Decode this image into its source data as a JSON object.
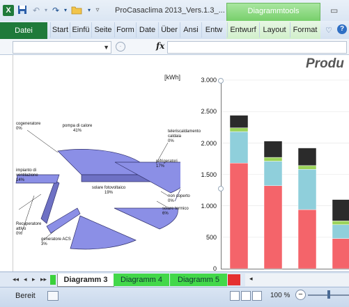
{
  "window": {
    "title": "ProCasaclima 2013_Vers.1.3_...",
    "contextual_group": "Diagrammtools"
  },
  "ribbon": {
    "file_tab": "Datei",
    "tabs": [
      "Start",
      "Einfü",
      "Seite",
      "Form",
      "Date",
      "Über",
      "Ansi",
      "Entw"
    ],
    "chart_tabs": [
      "Entwurf",
      "Layout",
      "Format"
    ]
  },
  "formula_bar": {
    "fx_label": "fx",
    "value": ""
  },
  "chart": {
    "title": "Produ",
    "unit_label": "[kWh]",
    "y_ticks": [
      "3.000",
      "2.500",
      "2.000",
      "1.500",
      "1.000",
      "500",
      "0"
    ],
    "pie_labels": [
      {
        "name": "cogeneratore",
        "pct": "0%"
      },
      {
        "name": "pompa di calore",
        "pct": "41%"
      },
      {
        "name": "teleriscaldamento caldaia",
        "pct": "0%"
      },
      {
        "name": "refrigeratori",
        "pct": "17%"
      },
      {
        "name": "impianto di ventilazione",
        "pct": "14%"
      },
      {
        "name": "solare fotovoltaico",
        "pct": "19%"
      },
      {
        "name": "non coperto",
        "pct": "0%"
      },
      {
        "name": "solare termico",
        "pct": "6%"
      },
      {
        "name": "Recuperatore attivo",
        "pct": "0%"
      },
      {
        "name": "generatore ACS",
        "pct": "3%"
      }
    ]
  },
  "chart_data": {
    "type": "bar",
    "ylabel": "[kWh]",
    "ylim": [
      0,
      3000
    ],
    "stacked": true,
    "series_colors": [
      "#f4646a",
      "#8fcfdb",
      "#9bd35a",
      "#2b2b2b"
    ],
    "series": [
      {
        "values": [
          1680,
          1320,
          940,
          480
        ]
      },
      {
        "values": [
          500,
          390,
          640,
          220
        ]
      },
      {
        "values": [
          60,
          60,
          60,
          60
        ]
      },
      {
        "values": [
          200,
          260,
          280,
          340
        ]
      }
    ],
    "categories": [
      "",
      "",
      "",
      ""
    ]
  },
  "sheets": {
    "tabs": [
      "Diagramm 3",
      "Diagramm 4",
      "Diagramm 5"
    ],
    "active": "Diagramm 3"
  },
  "status": {
    "mode": "Bereit",
    "zoom": "100 %"
  }
}
